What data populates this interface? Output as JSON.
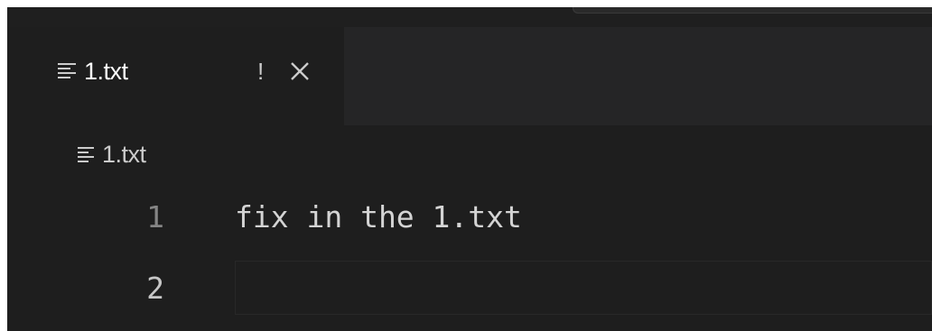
{
  "tab": {
    "label": "1.txt",
    "warning": "!",
    "icon": "file-lines-icon",
    "close_icon": "close-icon"
  },
  "breadcrumb": {
    "label": "1.txt",
    "icon": "file-lines-icon"
  },
  "editor": {
    "lines": [
      {
        "number": "1",
        "text": "fix in the 1.txt"
      },
      {
        "number": "2",
        "text": ""
      }
    ],
    "active_line": "2"
  },
  "colors": {
    "editor_background": "#1e1e1e",
    "tab_bar_background": "#252526",
    "text": "#d4d4d4",
    "line_number": "#858585",
    "active_line_number": "#c6c6c6"
  }
}
